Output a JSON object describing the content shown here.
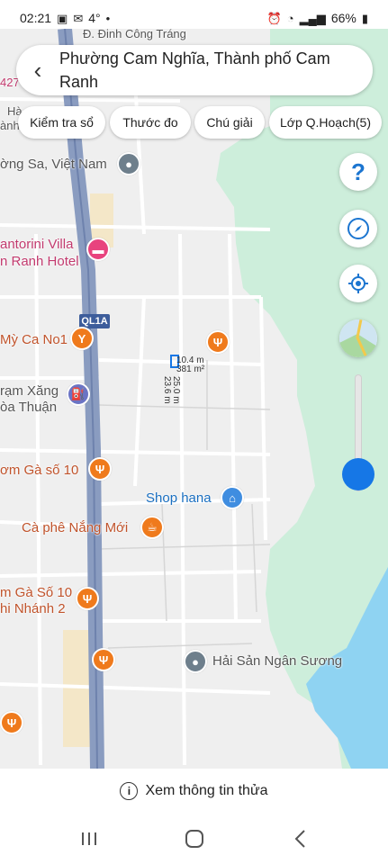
{
  "status": {
    "time": "02:21",
    "temp": "4°",
    "battery": "66%"
  },
  "header": {
    "back_icon": "chevron-left-icon",
    "title": "Phường Cam Nghĩa, Thành phố Cam Ranh"
  },
  "chips": [
    {
      "label": "Kiểm tra sổ"
    },
    {
      "label": "Thước đo"
    },
    {
      "label": "Chú giải"
    },
    {
      "label": "Lớp Q.Hoạch(5)"
    }
  ],
  "controls": {
    "help": "?",
    "icons": [
      "help-icon",
      "compass-icon",
      "my-location-icon",
      "map-layer-icon"
    ],
    "zoom_level": 0.15
  },
  "map": {
    "road_shield": "QL1A",
    "edge_text": {
      "top_street": "Đ. Đinh Công Tráng",
      "partial_number": "427",
      "partial_h": "Hà",
      "partial_anh": "ành"
    },
    "pois": [
      {
        "name": "ờng Sa, Việt Nam",
        "icon": "place-icon"
      },
      {
        "name": "antorini Villa",
        "icon": "hotel-icon"
      },
      {
        "name": "n Ranh Hotel",
        "icon": "hotel-icon"
      },
      {
        "name": "Mỳ Ca No1",
        "icon": "bar-icon"
      },
      {
        "name": "rạm Xăng",
        "icon": "gas-station-icon"
      },
      {
        "name": "òa Thuận",
        "icon": "gas-station-icon"
      },
      {
        "name": "ơm Gà số 10",
        "icon": "restaurant-icon"
      },
      {
        "name": "Shop hana",
        "icon": "shopping-icon"
      },
      {
        "name": "Cà phê Nắng Mới",
        "icon": "cafe-icon"
      },
      {
        "name": "m Gà Số 10",
        "icon": "restaurant-icon"
      },
      {
        "name": "hi Nhánh 2",
        "icon": "restaurant-icon"
      },
      {
        "name": "Hải Sản Ngân Sương",
        "icon": "place-icon"
      }
    ],
    "parcel": {
      "width_label": "10.4 m",
      "area_label": "381 m²",
      "len_a": "25.0 m",
      "len_b": "23.6 m"
    }
  },
  "info_bar": {
    "icon": "info-icon",
    "label": "Xem thông tin thửa"
  },
  "nav": {
    "icons": [
      "recent-apps-icon",
      "home-icon",
      "back-icon"
    ]
  },
  "colors": {
    "land": "#efefef",
    "green": "#cdeedb",
    "water": "#8fd3f2",
    "highway": "#8a9cc0",
    "accent": "#1677e6"
  }
}
